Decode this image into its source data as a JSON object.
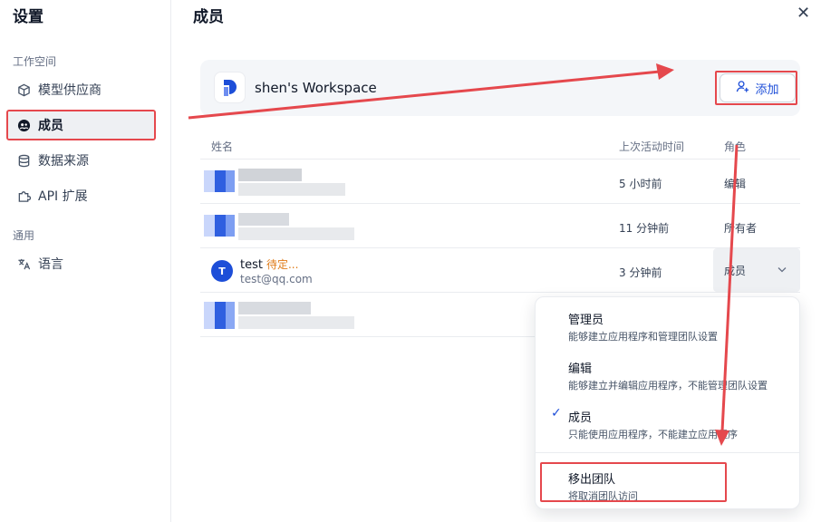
{
  "sidebar": {
    "title": "设置",
    "group_workspace": "工作空间",
    "group_general": "通用",
    "items": [
      {
        "label": "模型供应商",
        "icon": "cube-icon"
      },
      {
        "label": "成员",
        "icon": "members-icon"
      },
      {
        "label": "数据来源",
        "icon": "database-icon"
      },
      {
        "label": "API 扩展",
        "icon": "puzzle-icon"
      },
      {
        "label": "语言",
        "icon": "translate-icon"
      }
    ]
  },
  "main": {
    "title": "成员",
    "workspace_name": "shen's Workspace",
    "add_label": "添加",
    "columns": {
      "name": "姓名",
      "last_active": "上次活动时间",
      "role": "角色"
    },
    "rows": [
      {
        "last_active": "5 小时前",
        "role": "编辑"
      },
      {
        "last_active": "11 分钟前",
        "role": "所有者"
      },
      {
        "avatar": "T",
        "name": "test",
        "status": "待定...",
        "email": "test@qq.com",
        "last_active": "3 分钟前",
        "role": "成员"
      },
      {
        "last_active": "",
        "role": ""
      }
    ]
  },
  "dropdown": {
    "options": [
      {
        "title": "管理员",
        "desc": "能够建立应用程序和管理团队设置"
      },
      {
        "title": "编辑",
        "desc": "能够建立并编辑应用程序，不能管理团队设置"
      },
      {
        "title": "成员",
        "desc": "只能使用应用程序，不能建立应用程序"
      },
      {
        "title": "移出团队",
        "desc": "将取消团队访问"
      }
    ]
  },
  "colors": {
    "accent": "#1d4ed8",
    "annotation": "#e5484d",
    "pending": "#e07c1a"
  }
}
